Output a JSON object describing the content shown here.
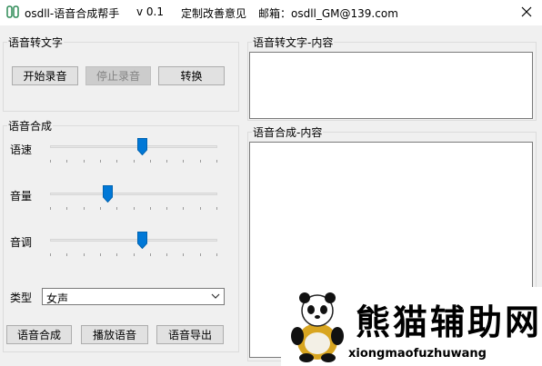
{
  "titlebar": {
    "app_title": "osdll-语音合成帮手",
    "version": "v 0.1",
    "feedback": "定制改善意见",
    "email": "邮箱：osdll_GM@139.com"
  },
  "speech_to_text": {
    "group_title": "语音转文字",
    "start_button": "开始录音",
    "stop_button": "停止录音",
    "convert_button": "转换",
    "content_title": "语音转文字-内容"
  },
  "synthesis": {
    "group_title": "语音合成",
    "sliders": [
      {
        "label": "语速",
        "value": 0.55
      },
      {
        "label": "音量",
        "value": 0.34
      },
      {
        "label": "音调",
        "value": 0.55
      }
    ],
    "type_label": "类型",
    "type_value": "女声",
    "synth_button": "语音合成",
    "play_button": "播放语音",
    "export_button": "语音导出",
    "content_title": "语音合成-内容"
  },
  "watermark": {
    "text": "熊猫辅助网",
    "subtext": "xiongmaofuzhuwang"
  },
  "colors": {
    "accent": "#0078d7",
    "window_bg": "#f0f0f0"
  }
}
